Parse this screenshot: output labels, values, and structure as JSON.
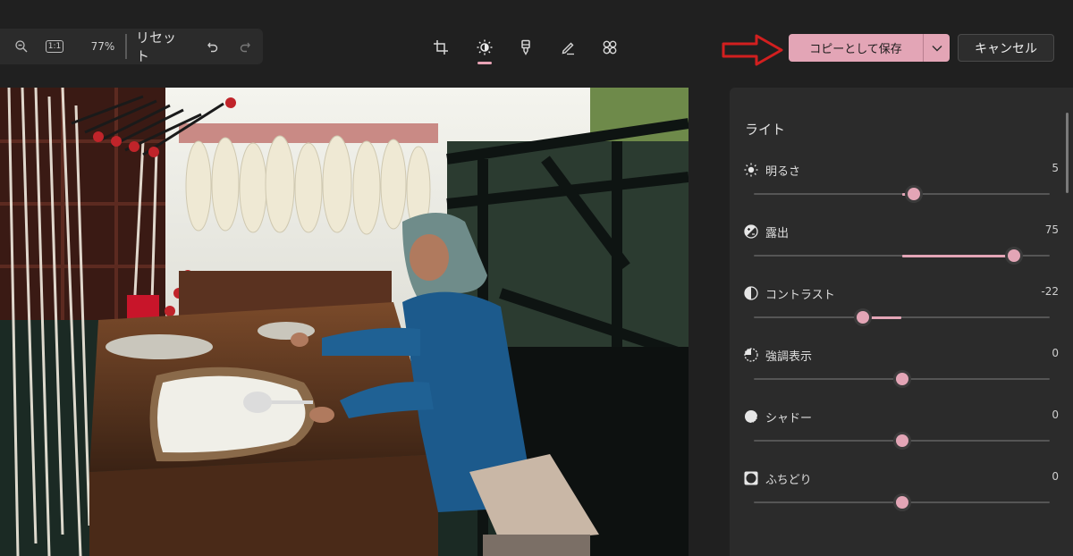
{
  "toolbar": {
    "zoom_pct": "77%",
    "reset_label": "リセット",
    "zoom_out_icon": "zoom-out-icon",
    "actual_size_label": "1:1",
    "undo_icon": "undo-icon",
    "redo_icon": "redo-icon"
  },
  "tools": [
    {
      "name": "crop",
      "icon": "crop-icon"
    },
    {
      "name": "adjust",
      "icon": "brightness-icon",
      "selected": true
    },
    {
      "name": "filter",
      "icon": "filter-icon"
    },
    {
      "name": "markup",
      "icon": "pen-icon"
    },
    {
      "name": "retouch",
      "icon": "retouch-icon"
    }
  ],
  "actions": {
    "save_label": "コピーとして保存",
    "cancel_label": "キャンセル"
  },
  "panel": {
    "section_title": "ライト",
    "sliders": [
      {
        "label": "明るさ",
        "value": "5",
        "fraction": 0.54,
        "icon": "sun-icon"
      },
      {
        "label": "露出",
        "value": "75",
        "fraction": 0.88,
        "icon": "exposure-icon"
      },
      {
        "label": "コントラスト",
        "value": "-22",
        "fraction": 0.37,
        "icon": "contrast-icon"
      },
      {
        "label": "強調表示",
        "value": "0",
        "fraction": 0.5,
        "icon": "highlights-icon"
      },
      {
        "label": "シャドー",
        "value": "0",
        "fraction": 0.5,
        "icon": "shadows-icon"
      },
      {
        "label": "ふちどり",
        "value": "0",
        "fraction": 0.5,
        "icon": "vignette-icon"
      }
    ]
  },
  "colors": {
    "accent": "#e3a5b6",
    "arrow": "#d21f1f",
    "background": "#202020",
    "panel": "#2b2b2b"
  }
}
